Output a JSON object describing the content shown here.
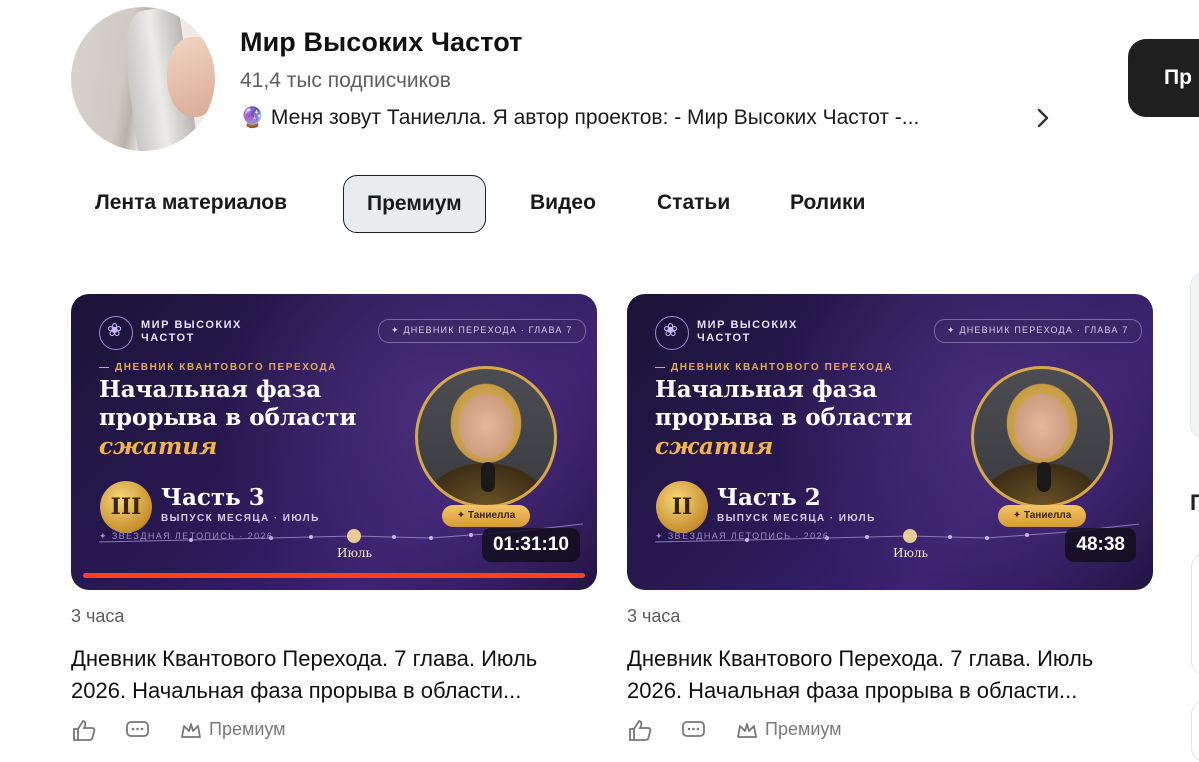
{
  "channel": {
    "title": "Мир Высоких Частот",
    "subscribers": "41,4 тыс подписчиков",
    "description_icon": "🔮",
    "description": "Меня зовут Таниелла. Я автор проектов: - Мир Высоких Частот -...",
    "subscribe_label": "Пр"
  },
  "tabs": [
    {
      "label": "Лента материалов",
      "active": false
    },
    {
      "label": "Премиум",
      "active": true
    },
    {
      "label": "Видео",
      "active": false
    },
    {
      "label": "Статьи",
      "active": false
    },
    {
      "label": "Ролики",
      "active": false
    }
  ],
  "cards": [
    {
      "thumb": {
        "brand": "МИР ВЫСОКИХ ЧАСТОТ",
        "pill": "✦ ДНЕВНИК ПЕРЕХОДА · ГЛАВА 7",
        "kicker": "— ДНЕВНИК КВАНТОВОГО ПЕРЕХОДА",
        "headline": "Начальная фаза прорыва в области",
        "headline_accent": "сжатия",
        "numeral": "III",
        "part": "Часть 3",
        "issue": "ВЫПУСК МЕСЯЦА · ИЮЛЬ",
        "chronicle": "✦ ЗВЁЗДНАЯ ЛЕТОПИСЬ · 2026",
        "month": "Июль",
        "nameplate": "✦ Таниелла"
      },
      "duration": "01:31:10",
      "watched_fraction": 1.0,
      "time_ago": "3 часа",
      "title": "Дневник Квантового Перехода. 7 глава. Июль 2026. Начальная фаза прорыва в области...",
      "tag": "Премиум"
    },
    {
      "thumb": {
        "brand": "МИР ВЫСОКИХ ЧАСТОТ",
        "pill": "✦ ДНЕВНИК ПЕРЕХОДА · ГЛАВА 7",
        "kicker": "— ДНЕВНИК КВАНТОВОГО ПЕРЕХОДА",
        "headline": "Начальная фаза прорыва в области",
        "headline_accent": "сжатия",
        "numeral": "II",
        "part": "Часть 2",
        "issue": "ВЫПУСК МЕСЯЦА · ИЮЛЬ",
        "chronicle": "✦ ЗВЁЗДНАЯ ЛЕТОПИСЬ · 2026",
        "month": "Июль",
        "nameplate": "✦ Таниелла"
      },
      "duration": "48:38",
      "watched_fraction": 0,
      "time_ago": "3 часа",
      "title": "Дневник Квантового Перехода. 7 глава. Июль 2026. Начальная фаза прорыва в области...",
      "tag": "Премиум"
    }
  ],
  "sidebar": {
    "partial_heading": "П"
  },
  "icons": [
    "avatar",
    "globe-icon",
    "chevron-right-icon",
    "like-icon",
    "comment-icon",
    "premium-crown-icon"
  ]
}
